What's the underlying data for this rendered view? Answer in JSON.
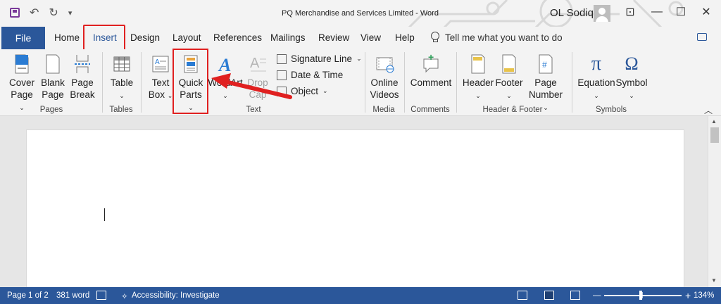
{
  "title_bar": {
    "quick_access": {
      "undo": "↶",
      "redo": "↻",
      "customize": "▾"
    },
    "document_title": "PQ Merchandise and Services Limited  -  Word",
    "user_name": "OL Sodiq",
    "window_controls": {
      "ribbon_display": "⊡",
      "minimize": "—",
      "maximize": "☐",
      "close": "✕"
    }
  },
  "tabs": [
    {
      "label": "File"
    },
    {
      "label": "Home"
    },
    {
      "label": "Insert"
    },
    {
      "label": "Design"
    },
    {
      "label": "Layout"
    },
    {
      "label": "References"
    },
    {
      "label": "Mailings"
    },
    {
      "label": "Review"
    },
    {
      "label": "View"
    },
    {
      "label": "Help"
    }
  ],
  "tell_me": "Tell me what you want to do",
  "ribbon": {
    "groups": {
      "pages": "Pages",
      "tables": "Tables",
      "text": "Text",
      "media": "Media",
      "comments": "Comments",
      "header_footer": "Header & Footer",
      "symbols": "Symbols"
    },
    "buttons": {
      "cover_page": [
        "Cover",
        "Page"
      ],
      "blank_page": [
        "Blank",
        "Page"
      ],
      "page_break": [
        "Page",
        "Break"
      ],
      "table": "Table",
      "text_box": [
        "Text",
        "Box"
      ],
      "quick_parts": [
        "Quick",
        "Parts"
      ],
      "wordart": [
        "WordArt"
      ],
      "drop_cap": [
        "Drop",
        "Cap"
      ],
      "signature_line": "Signature Line",
      "date_time": "Date & Time",
      "object": "Object",
      "online_videos": [
        "Online",
        "Videos"
      ],
      "comment": "Comment",
      "header": "Header",
      "footer": "Footer",
      "page_number": [
        "Page",
        "Number"
      ],
      "equation": "Equation",
      "symbol": "Symbol"
    },
    "icon_glyphs": {
      "equation": "π",
      "symbol": "Ω",
      "page_number": "#",
      "comment_plus": "+"
    },
    "caret": "⌄",
    "collapse": "︿"
  },
  "status_bar": {
    "page": "Page 1 of 2",
    "words": "381 word",
    "accessibility": "Accessibility: Investigate",
    "zoom_minus": "—",
    "zoom_plus": "+",
    "zoom_level": "134%"
  },
  "annotations": {
    "highlight_color": "#e02020",
    "accent_color": "#2b579a"
  }
}
